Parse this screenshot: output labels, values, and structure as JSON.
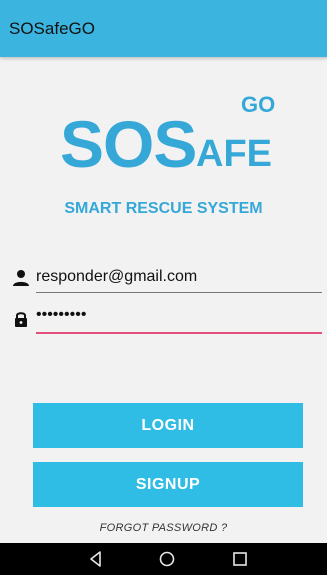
{
  "app_bar": {
    "title": "SOSafeGO"
  },
  "logo": {
    "go": "GO",
    "sos": "SOS",
    "afe": "AFE",
    "tagline": "SMART RESCUE SYSTEM",
    "color": "#35a8d8"
  },
  "form": {
    "email": {
      "icon": "person-icon",
      "value": "responder@gmail.com"
    },
    "password": {
      "icon": "lock-icon",
      "value": "•••••••••"
    }
  },
  "buttons": {
    "login_label": "LOGIN",
    "signup_label": "SIGNUP",
    "color": "#2fbde6"
  },
  "forgot_password": "FORGOT PASSWORD ?",
  "nav": {
    "back": "back-icon",
    "home": "home-icon",
    "recents": "recents-icon"
  },
  "colors": {
    "app_bar": "#3bb5e0",
    "focus_underline": "#e0507a"
  }
}
